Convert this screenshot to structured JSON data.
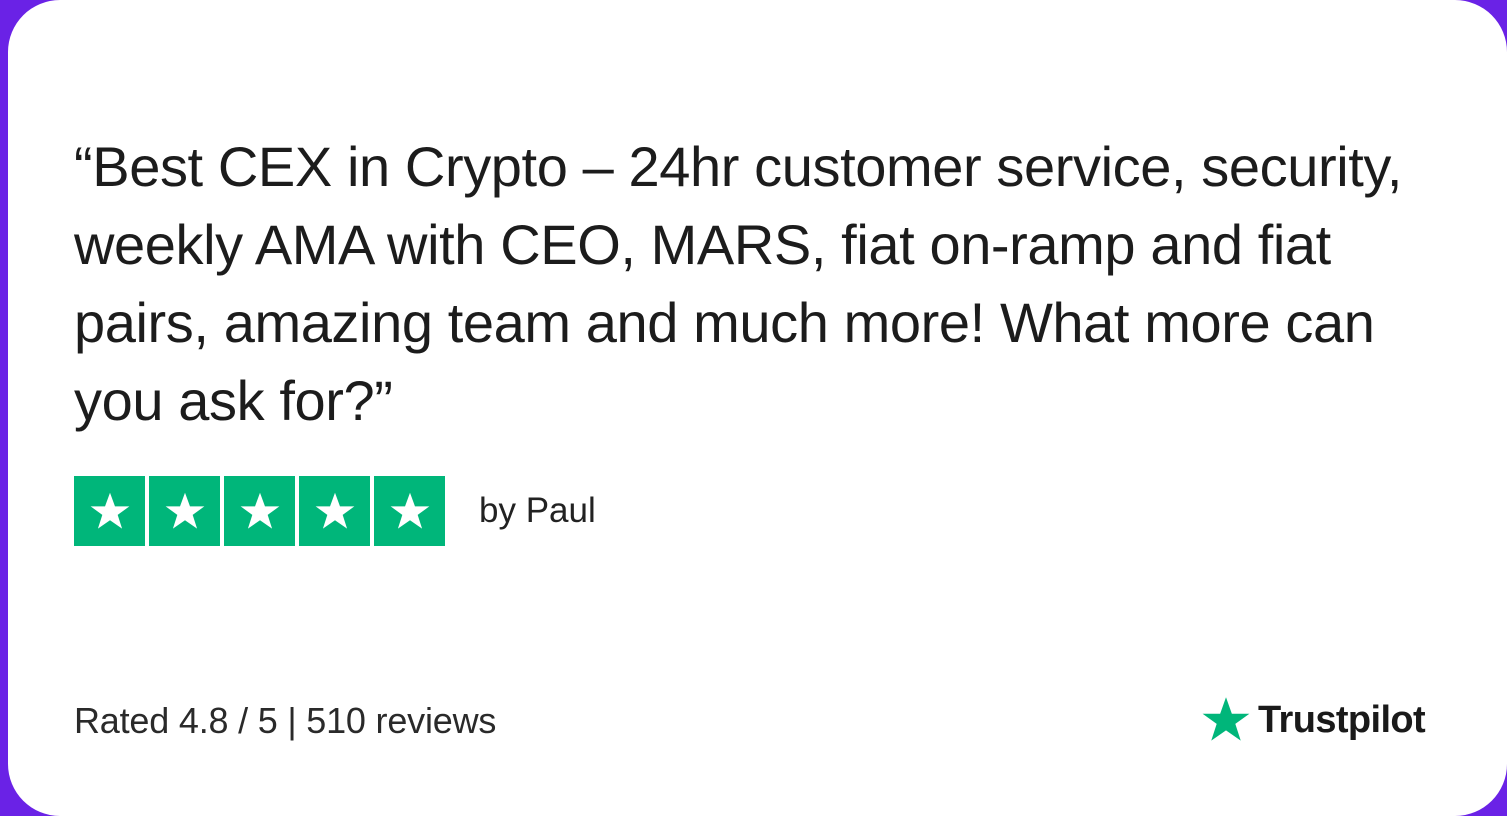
{
  "review": {
    "quote": "“Best CEX in Crypto  –  24hr customer service, security, weekly AMA with CEO, MARS, fiat on-ramp and fiat pairs, amazing team and much more! What more can you ask for?”",
    "author": "by Paul",
    "stars": 5,
    "max_stars": 5
  },
  "summary": {
    "text": "Rated 4.8 / 5 | 510 reviews"
  },
  "brand": {
    "name": "Trustpilot",
    "icon": "star-icon"
  },
  "colors": {
    "background": "#6a22e6",
    "card": "#ffffff",
    "star_green": "#00b67a",
    "text": "#1c1c1c"
  }
}
